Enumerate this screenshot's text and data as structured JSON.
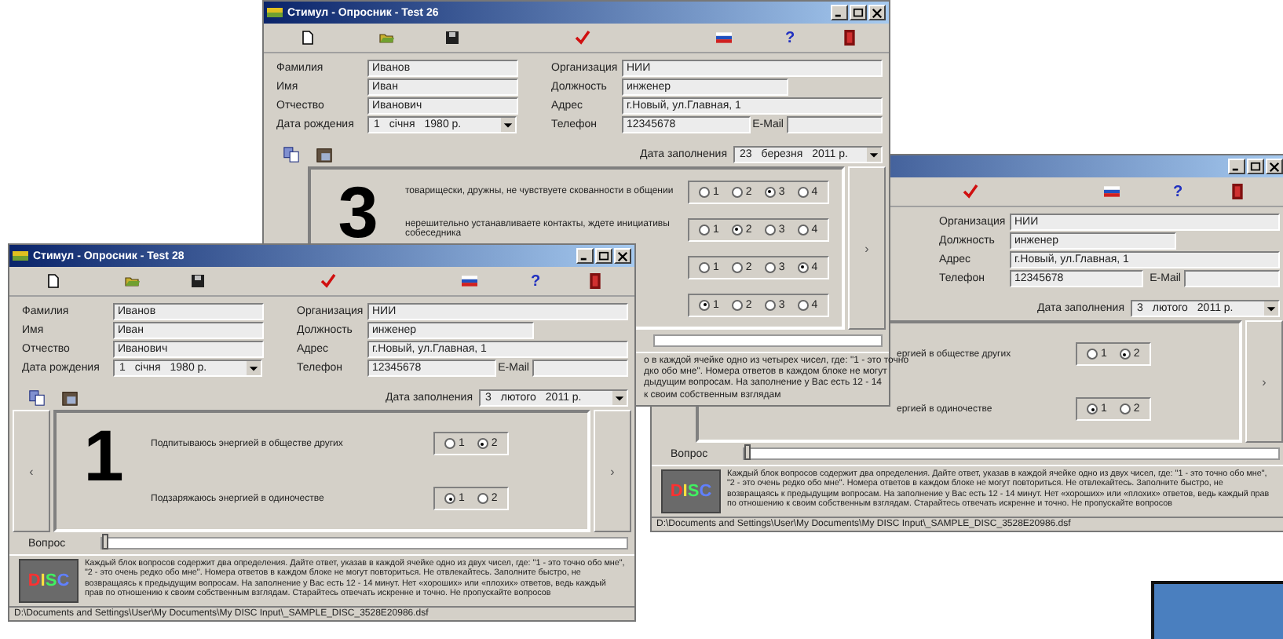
{
  "slide": {
    "shape": true
  },
  "windows": [
    {
      "title": "Стимул - Опросник - Test 26",
      "tools": [
        {
          "kind": "new"
        },
        {
          "kind": "open"
        },
        {
          "kind": "save"
        },
        {
          "kind": "check"
        },
        {
          "kind": "flag"
        },
        {
          "kind": "help",
          "glyph": "?"
        },
        {
          "kind": "exit"
        }
      ],
      "form": {
        "left": [
          {
            "label": "Фамилия",
            "value": "Иванов",
            "kind": "text"
          },
          {
            "label": "Имя",
            "value": "Иван",
            "kind": "text"
          },
          {
            "label": "Отчество",
            "value": "Иванович",
            "kind": "text"
          },
          {
            "label": "Дата рождения",
            "parts": [
              "1",
              "січня",
              "1980 р."
            ],
            "kind": "date"
          }
        ],
        "right": [
          {
            "label": "Организация",
            "value": "НИИ",
            "kind": "wide"
          },
          {
            "label": "Должность",
            "value": "инженер",
            "kind": "medium"
          },
          {
            "label": "Адрес",
            "value": "г.Новый, ул.Главная, 1",
            "kind": "wide"
          },
          {
            "label": "Телефон",
            "value": "12345678",
            "kind": "phone"
          },
          {
            "label": "E-Mail",
            "kind": "email"
          }
        ]
      },
      "side_icons": true,
      "fill_date": {
        "label": "Дата заполнения",
        "parts": [
          "23",
          "березня",
          "2011 р."
        ]
      },
      "panel": {
        "number": "3",
        "next": "›",
        "questions": [
          {
            "text": "товарищески, дружны, не чувствуете скованности в общении",
            "options": [
              {
                "label": "1",
                "selected": false
              },
              {
                "label": "2",
                "selected": false
              },
              {
                "label": "3",
                "selected": true
              },
              {
                "label": "4",
                "selected": false
              }
            ]
          },
          {
            "text": "нерешительно устанавливаете контакты, ждете инициативы собеседника",
            "options": [
              {
                "label": "1",
                "selected": false
              },
              {
                "label": "2",
                "selected": true
              },
              {
                "label": "3",
                "selected": false
              },
              {
                "label": "4",
                "selected": false
              }
            ]
          },
          {
            "options": [
              {
                "label": "1",
                "selected": false
              },
              {
                "label": "2",
                "selected": false
              },
              {
                "label": "3",
                "selected": false
              },
              {
                "label": "4",
                "selected": true
              }
            ]
          },
          {
            "options": [
              {
                "label": "1",
                "selected": true
              },
              {
                "label": "2",
                "selected": false
              },
              {
                "label": "3",
                "selected": false
              },
              {
                "label": "4",
                "selected": false
              }
            ]
          }
        ]
      },
      "question_bar": {
        "visible": true
      },
      "instruction": {
        "lines": [
          "о в каждой ячейке одно из четырех чисел, где: \"1 - это точно",
          "дко обо мне\". Номера ответов в каждом блоке не могут",
          "дыдущим вопросам. На заполнение у Вас есть 12 - 14",
          "к своим собственным взглядам"
        ]
      }
    },
    {
      "tools": [
        {
          "kind": "check"
        },
        {
          "kind": "flag"
        },
        {
          "kind": "help",
          "glyph": "?"
        },
        {
          "kind": "exit"
        }
      ],
      "form": {
        "right": [
          {
            "label": "Организация",
            "value": "НИИ",
            "kind": "wide"
          },
          {
            "label": "Должность",
            "value": "инженер",
            "kind": "medium"
          },
          {
            "label": "Адрес",
            "value": "г.Новый, ул.Главная, 1",
            "kind": "wide"
          },
          {
            "label": "Телефон",
            "value": "12345678",
            "kind": "phone"
          },
          {
            "label": "E-Mail",
            "kind": "email"
          }
        ]
      },
      "fill_date": {
        "label": "Дата заполнения",
        "parts": [
          "3",
          "лютого",
          "2011 р."
        ]
      },
      "panel": {
        "next": "›",
        "questions": [
          {
            "text": "ергией в обществе других",
            "options": [
              {
                "label": "1",
                "selected": false
              },
              {
                "label": "2",
                "selected": true
              }
            ]
          },
          {
            "text": "ергией в одиночестве",
            "options": [
              {
                "label": "1",
                "selected": true
              },
              {
                "label": "2",
                "selected": false
              }
            ]
          }
        ]
      },
      "question_bar": {
        "visible": true,
        "label": "Вопрос",
        "level": 0
      },
      "instruction": {
        "logo": "DISC",
        "text": "Каждый блок вопросов содержит два определения. Дайте ответ, указав в каждой ячейке одно из двух чисел, где: \"1 - это точно обо мне\", \"2 - это очень редко обо мне\". Номера ответов в каждом блоке не могут повториться. Не отвлекайтесь. Заполните быстро, не возвращаясь к предыдущим вопросам. На заполнение у Вас есть 12 - 14 минут. Нет «хороших» или «плохих» ответов, ведь каждый прав по отношению к своим собственным взглядам. Старайтесь отвечать искренне и точно. Не пропускайте вопросов"
      },
      "status": "D:\\Documents and Settings\\User\\My Documents\\My DISC Input\\_SAMPLE_DISC_3528E20986.dsf"
    },
    {
      "title": "Стимул - Опросник - Test 28",
      "tools": [
        {
          "kind": "new"
        },
        {
          "kind": "open"
        },
        {
          "kind": "save"
        },
        {
          "kind": "check"
        },
        {
          "kind": "flag"
        },
        {
          "kind": "help",
          "glyph": "?"
        },
        {
          "kind": "exit"
        }
      ],
      "form": {
        "left": [
          {
            "label": "Фамилия",
            "value": "Иванов",
            "kind": "text"
          },
          {
            "label": "Имя",
            "value": "Иван",
            "kind": "text"
          },
          {
            "label": "Отчество",
            "value": "Иванович",
            "kind": "text"
          },
          {
            "label": "Дата рождения",
            "parts": [
              "1",
              "січня",
              "1980 р."
            ],
            "kind": "date"
          }
        ],
        "right": [
          {
            "label": "Организация",
            "value": "НИИ",
            "kind": "wide"
          },
          {
            "label": "Должность",
            "value": "инженер",
            "kind": "medium"
          },
          {
            "label": "Адрес",
            "value": "г.Новый, ул.Главная, 1",
            "kind": "wide"
          },
          {
            "label": "Телефон",
            "value": "12345678",
            "kind": "phone"
          },
          {
            "label": "E-Mail",
            "kind": "email"
          }
        ]
      },
      "side_icons": true,
      "fill_date": {
        "label": "Дата заполнения",
        "parts": [
          "3",
          "лютого",
          "2011 р."
        ]
      },
      "panel": {
        "prev": "‹",
        "number": "1",
        "next": "›",
        "questions": [
          {
            "text": "Подпитываюсь энергией в обществе других",
            "options": [
              {
                "label": "1",
                "selected": false
              },
              {
                "label": "2",
                "selected": true
              }
            ]
          },
          {
            "text": "Подзаряжаюсь энергией в одиночестве",
            "options": [
              {
                "label": "1",
                "selected": true
              },
              {
                "label": "2",
                "selected": false
              }
            ]
          }
        ]
      },
      "question_bar": {
        "visible": true,
        "label": "Вопрос",
        "level": 0
      },
      "instruction": {
        "logo": "DISC",
        "text": "Каждый блок вопросов содержит два определения. Дайте ответ, указав в каждой ячейке одно из двух чисел, где: \"1 - это точно обо мне\", \"2 - это очень редко обо мне\". Номера ответов в каждом блоке не могут повториться. Не отвлекайтесь. Заполните быстро, не возвращаясь к предыдущим вопросам. На заполнение у Вас есть 12 - 14 минут. Нет «хороших» или «плохих» ответов, ведь каждый прав по отношению к своим собственным взглядам. Старайтесь отвечать искренне и точно. Не пропускайте вопросов"
      },
      "status": "D:\\Documents and Settings\\User\\My Documents\\My DISC Input\\_SAMPLE_DISC_3528E20986.dsf"
    }
  ]
}
